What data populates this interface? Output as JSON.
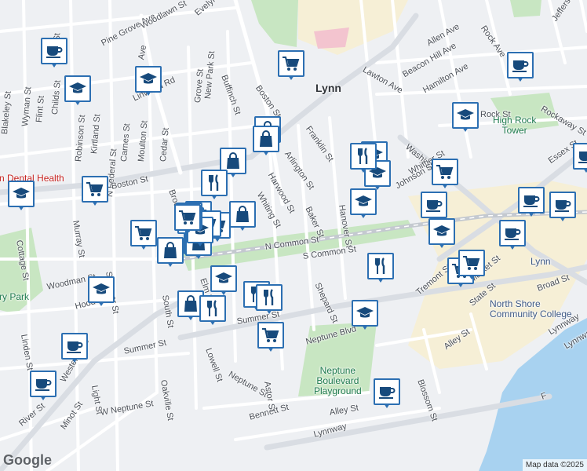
{
  "map": {
    "colors": {
      "land": "#eef0f3",
      "road": "#ffffff",
      "arterial": "#d9dde3",
      "park": "#c8e6c2",
      "water": "#a8d2f0",
      "urban": "#f6efd6"
    },
    "city_label": "Lynn",
    "pois": [
      {
        "id": "lynn-dental",
        "text": "rn Dental Health",
        "style": "poi-red"
      },
      {
        "id": "high-rock",
        "text": "High Rock\nTower",
        "style": "poi"
      },
      {
        "id": "neptune-playground",
        "text": "Neptune\nBoulevard\nPlayground",
        "style": "poi"
      },
      {
        "id": "north-shore-cc",
        "text": "North Shore\nCommunity College",
        "style": "poi-blue"
      },
      {
        "id": "lynn-station",
        "text": "Lynn",
        "style": "poi-blue"
      },
      {
        "id": "ry-park",
        "text": "rry Park",
        "style": "poi"
      }
    ],
    "streets": [
      "Pine Grove Ave",
      "Woodlawn St",
      "Evelyn St",
      "Buffinch St",
      "New Park St",
      "Grove St",
      "Linwood Rd",
      "Ave",
      "Clark St",
      "Childs St",
      "Flint St",
      "Wyman St",
      "Blakeley St",
      "Robinson St",
      "Kirtland St",
      "Carnes St",
      "Moulton St",
      "Cedar St",
      "N Federal St",
      "Boston St",
      "Boston St",
      "Arlington St",
      "Harwood St",
      "Whiting St",
      "Franklin St",
      "Baker St",
      "Hanover St",
      "N Common St",
      "S Common St",
      "Shepard St",
      "Washington St",
      "Whittier St",
      "Johnson St",
      "Allen Ave",
      "Beacon Hill Ave",
      "Hamilton Ave",
      "Lawton Ave",
      "Rock Ave",
      "Jefferson",
      "Rockaway St",
      "Rock St",
      "Essex St",
      "Tremont St",
      "Market St",
      "State St",
      "Broad St",
      "Lynnway",
      "Alley St",
      "Blossom St",
      "Neptune Blvd",
      "Neptune St",
      "Summer St",
      "Summer St",
      "Lowell St",
      "Oakville St",
      "Light St",
      "South St",
      "Elm St",
      "Brook St",
      "Spencer St",
      "Woodman St",
      "Murray St",
      "Cottage St",
      "Linden St",
      "Hood St",
      "Western Ave",
      "W Neptune St",
      "Bennett St",
      "Alley St",
      "Minot St",
      "River St",
      "Astor St",
      "Lynnway",
      "Lynnway",
      "F",
      "Pa"
    ],
    "markers": [
      "cup",
      "grad",
      "grad",
      "cart",
      "cup",
      "grad",
      "cart",
      "grad",
      "grad",
      "cup",
      "grad",
      "cup",
      "fork",
      "bag",
      "cart",
      "bag",
      "bag",
      "fork",
      "bag",
      "cart",
      "cart",
      "cart",
      "bag",
      "bag",
      "grad",
      "fork",
      "grad",
      "grad",
      "cart",
      "cup",
      "grad",
      "cup",
      "cup",
      "grad",
      "cart",
      "cart",
      "fork",
      "fork",
      "bag",
      "fork",
      "cart",
      "cart",
      "bag",
      "grad",
      "grad",
      "cart",
      "cup",
      "cup",
      "cup"
    ]
  },
  "branding": {
    "logo": "Google",
    "attribution": "Map data ©2025"
  }
}
